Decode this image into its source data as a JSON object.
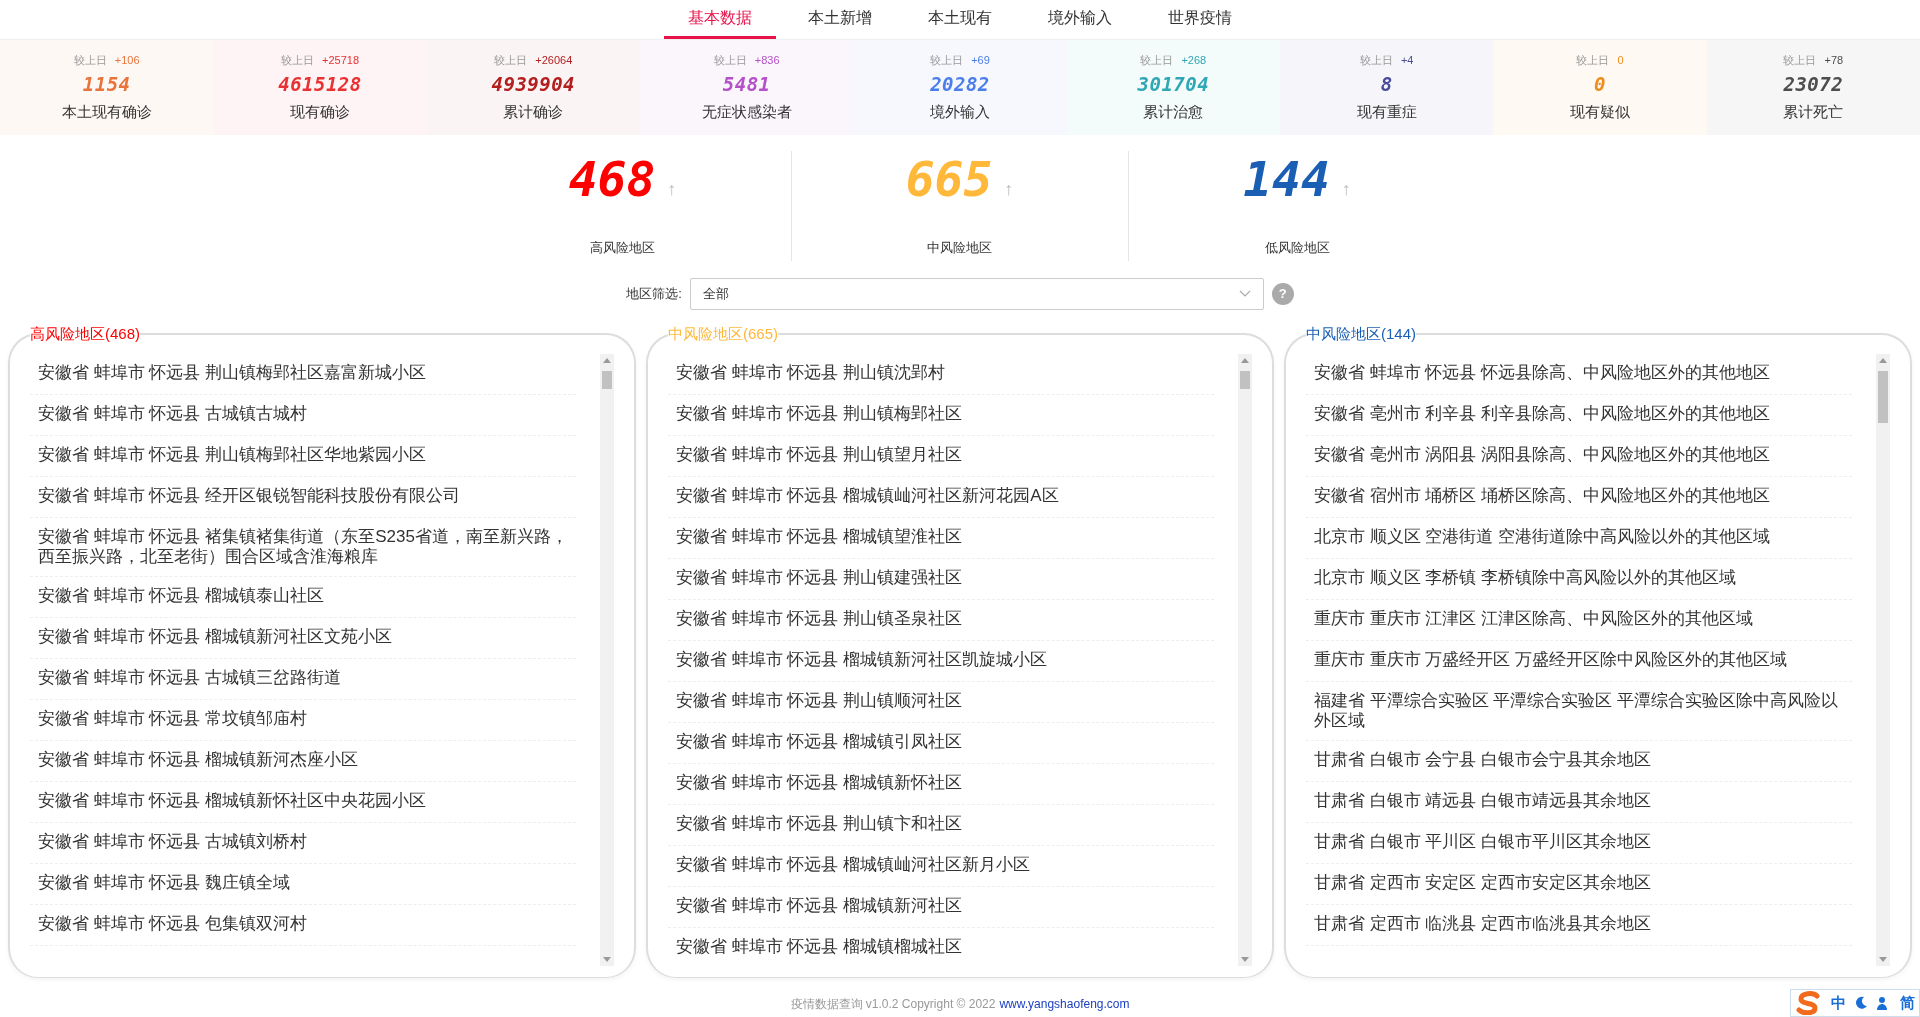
{
  "tabs": [
    {
      "label": "基本数据",
      "selected": true
    },
    {
      "label": "本土新增",
      "selected": false
    },
    {
      "label": "本土现有",
      "selected": false
    },
    {
      "label": "境外输入",
      "selected": false
    },
    {
      "label": "世界疫情",
      "selected": false
    }
  ],
  "stats": [
    {
      "compare_label": "较上日",
      "delta": "+106",
      "value": "1154",
      "label": "本土现有确诊",
      "color": "#e8743b"
    },
    {
      "compare_label": "较上日",
      "delta": "+25718",
      "value": "4615128",
      "label": "现有确诊",
      "color": "#e83132"
    },
    {
      "compare_label": "较上日",
      "delta": "+26064",
      "value": "4939904",
      "label": "累计确诊",
      "color": "#b31e1e"
    },
    {
      "compare_label": "较上日",
      "delta": "+836",
      "value": "5481",
      "label": "无症状感染者",
      "color": "#b450c8"
    },
    {
      "compare_label": "较上日",
      "delta": "+69",
      "value": "20282",
      "label": "境外输入",
      "color": "#4a7ee8"
    },
    {
      "compare_label": "较上日",
      "delta": "+268",
      "value": "301704",
      "label": "累计治愈",
      "color": "#2fa7b5"
    },
    {
      "compare_label": "较上日",
      "delta": "+4",
      "value": "8",
      "label": "现有重症",
      "color": "#4b4b9b"
    },
    {
      "compare_label": "较上日",
      "delta": "0",
      "value": "0",
      "label": "现有疑似",
      "color": "#f08c1a"
    },
    {
      "compare_label": "较上日",
      "delta": "+78",
      "value": "23072",
      "label": "累计死亡",
      "color": "#4d4d4d"
    }
  ],
  "risk_summary": [
    {
      "value": "468",
      "arrow": "↑",
      "label": "高风险地区",
      "color": "#ff0000"
    },
    {
      "value": "665",
      "arrow": "↑",
      "label": "中风险地区",
      "color": "#ffb83a"
    },
    {
      "value": "144",
      "arrow": "↑",
      "label": "低风险地区",
      "color": "#1a5fb4"
    }
  ],
  "filter": {
    "label": "地区筛选:",
    "value": "全部",
    "help": "?"
  },
  "panels": [
    {
      "title": "高风险地区(468)",
      "color": "#ff0000",
      "items": [
        "安徽省 蚌埠市 怀远县 荆山镇梅郢社区嘉富新城小区",
        "安徽省 蚌埠市 怀远县 古城镇古城村",
        "安徽省 蚌埠市 怀远县 荆山镇梅郢社区华地紫园小区",
        "安徽省 蚌埠市 怀远县 经开区银锐智能科技股份有限公司",
        "安徽省 蚌埠市 怀远县 褚集镇褚集街道（东至S235省道，南至新兴路，西至振兴路，北至老街）围合区域含淮海粮库",
        "安徽省 蚌埠市 怀远县 榴城镇泰山社区",
        "安徽省 蚌埠市 怀远县 榴城镇新河社区文苑小区",
        "安徽省 蚌埠市 怀远县 古城镇三岔路街道",
        "安徽省 蚌埠市 怀远县 常坟镇邹庙村",
        "安徽省 蚌埠市 怀远县 榴城镇新河杰座小区",
        "安徽省 蚌埠市 怀远县 榴城镇新怀社区中央花园小区",
        "安徽省 蚌埠市 怀远县 古城镇刘桥村",
        "安徽省 蚌埠市 怀远县 魏庄镇全域",
        "安徽省 蚌埠市 怀远县 包集镇双河村"
      ]
    },
    {
      "title": "中风险地区(665)",
      "color": "#ffb83a",
      "items": [
        "安徽省 蚌埠市 怀远县 荆山镇沈郢村",
        "安徽省 蚌埠市 怀远县 荆山镇梅郢社区",
        "安徽省 蚌埠市 怀远县 荆山镇望月社区",
        "安徽省 蚌埠市 怀远县 榴城镇屾河社区新河花园A区",
        "安徽省 蚌埠市 怀远县 榴城镇望淮社区",
        "安徽省 蚌埠市 怀远县 荆山镇建强社区",
        "安徽省 蚌埠市 怀远县 荆山镇圣泉社区",
        "安徽省 蚌埠市 怀远县 榴城镇新河社区凯旋城小区",
        "安徽省 蚌埠市 怀远县 荆山镇顺河社区",
        "安徽省 蚌埠市 怀远县 榴城镇引凤社区",
        "安徽省 蚌埠市 怀远县 榴城镇新怀社区",
        "安徽省 蚌埠市 怀远县 荆山镇卞和社区",
        "安徽省 蚌埠市 怀远县 榴城镇屾河社区新月小区",
        "安徽省 蚌埠市 怀远县 榴城镇新河社区",
        "安徽省 蚌埠市 怀远县 榴城镇榴城社区"
      ]
    },
    {
      "title": "中风险地区(144)",
      "color": "#1a5fb4",
      "items": [
        "安徽省 蚌埠市 怀远县 怀远县除高、中风险地区外的其他地区",
        "安徽省 亳州市 利辛县 利辛县除高、中风险地区外的其他地区",
        "安徽省 亳州市 涡阳县 涡阳县除高、中风险地区外的其他地区",
        "安徽省 宿州市 埇桥区 埇桥区除高、中风险地区外的其他地区",
        "北京市 顺义区 空港街道 空港街道除中高风险以外的其他区域",
        "北京市 顺义区 李桥镇 李桥镇除中高风险以外的其他区域",
        "重庆市 重庆市 江津区 江津区除高、中风险区外的其他区域",
        "重庆市 重庆市 万盛经开区 万盛经开区除中风险区外的其他区域",
        "福建省 平潭综合实验区 平潭综合实验区 平潭综合实验区除中高风险以外区域",
        "甘肃省 白银市 会宁县 白银市会宁县其余地区",
        "甘肃省 白银市 靖远县 白银市靖远县其余地区",
        "甘肃省 白银市 平川区 白银市平川区其余地区",
        "甘肃省 定西市 安定区 定西市安定区其余地区",
        "甘肃省 定西市 临洮县 定西市临洮县其余地区"
      ]
    }
  ],
  "footer": {
    "text": "疫情数据查询 v1.0.2 Copyright © 2022",
    "link": "www.yangshaofeng.com"
  },
  "ime_toolbar": {
    "mode": "中",
    "charset": "简"
  }
}
